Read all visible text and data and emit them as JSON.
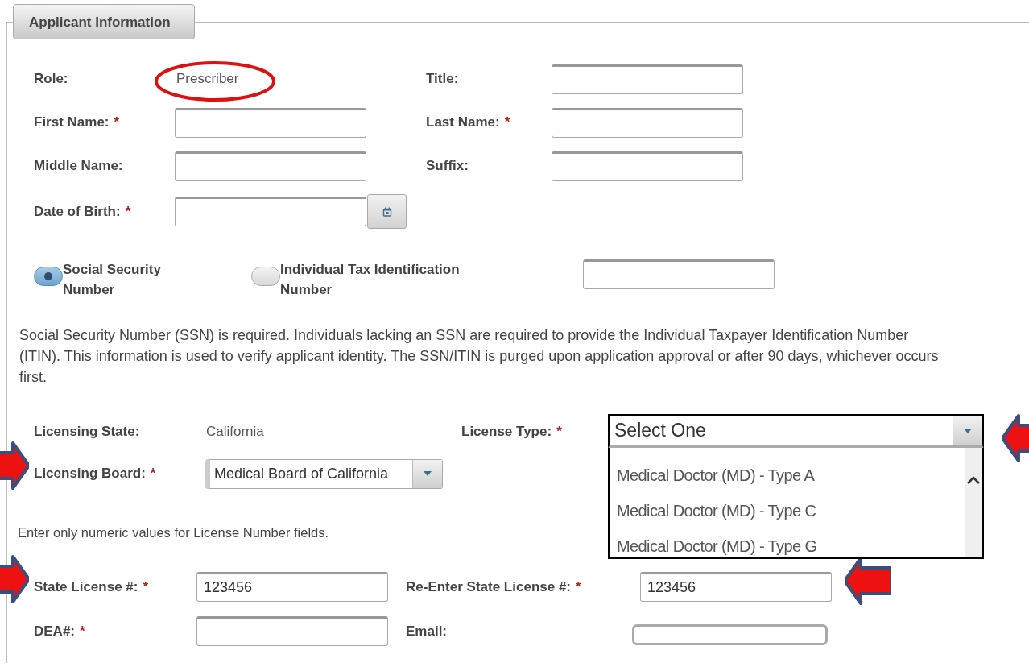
{
  "section_title": "Applicant Information",
  "personal_rows": [
    [
      {
        "kind": "text",
        "label": "Role:",
        "value": "Prescriber",
        "circled": true
      },
      {
        "kind": "input",
        "label": "Title:"
      }
    ],
    [
      {
        "kind": "input",
        "label": "First Name:",
        "required_mark": "*"
      },
      {
        "kind": "input",
        "label": "Last Name:",
        "required_mark": "*"
      }
    ],
    [
      {
        "kind": "input",
        "label": "Middle Name:"
      },
      {
        "kind": "input",
        "label": "Suffix:"
      }
    ],
    [
      {
        "kind": "date",
        "label": "Date of Birth:",
        "required_mark": "*"
      }
    ]
  ],
  "id_type": {
    "options": [
      {
        "label": "Social Security Number",
        "selected": true
      },
      {
        "label": "Individual Tax Identification Number",
        "selected": false
      }
    ]
  },
  "notice": "Social Security Number (SSN) is required. Individuals lacking an SSN are required to provide the Individual Taxpayer Identification Number (ITIN). This information is used to verify applicant identity. The SSN/ITIN is purged upon application approval or after 90 days, whichever occurs first.",
  "licensing_rows": [
    [
      {
        "kind": "text",
        "label": "Licensing State:",
        "value": "California"
      },
      {
        "kind": "select",
        "label": "License Type:",
        "required_mark": "*",
        "value": "Select One",
        "expanded": true,
        "pointed_left": true,
        "options": [
          "Medical Doctor (MD) - Type A",
          "Medical Doctor (MD) - Type C",
          "Medical Doctor (MD) - Type G"
        ]
      }
    ],
    [
      {
        "kind": "select",
        "label": "Licensing Board:",
        "required_mark": "*",
        "value": "Medical Board of California",
        "expanded": false,
        "pointed_right": true
      }
    ]
  ],
  "license_note": "Enter only numeric values for License Number fields.",
  "license_rows": [
    [
      {
        "kind": "input",
        "label": "State License #:",
        "required_mark": "*",
        "value": "123456",
        "pointed_right": true
      },
      {
        "kind": "input",
        "label": "Re-Enter State License #:",
        "required_mark": "*",
        "value": "123456",
        "pointed_left": true
      }
    ],
    [
      {
        "kind": "input",
        "label": "DEA#:",
        "required_mark": "*"
      },
      {
        "kind": "email",
        "label": "Email:"
      }
    ]
  ]
}
